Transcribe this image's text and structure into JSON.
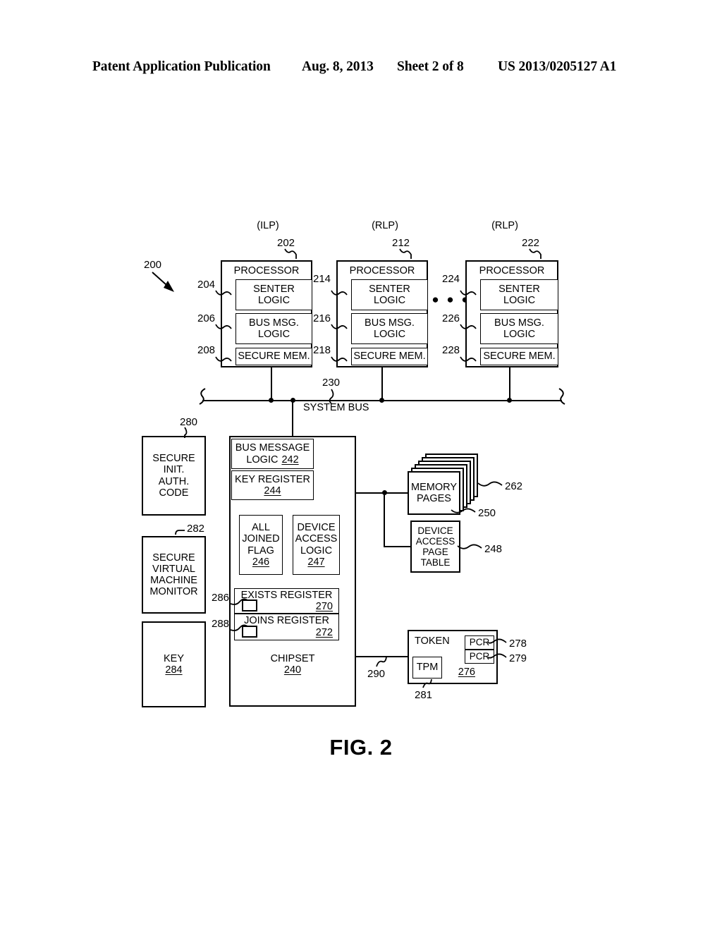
{
  "header": {
    "publication": "Patent Application Publication",
    "date": "Aug. 8, 2013",
    "sheet": "Sheet 2 of 8",
    "patent_number": "US 2013/0205127 A1"
  },
  "figure": {
    "caption": "FIG. 2",
    "system_ref": "200",
    "system_bus": {
      "label": "SYSTEM BUS",
      "ref": "230"
    },
    "processors": [
      {
        "type_label": "(ILP)",
        "ref": "202",
        "title": "PROCESSOR",
        "blocks": [
          {
            "label": "SENTER LOGIC",
            "line1": "SENTER",
            "line2": "LOGIC",
            "ref": "204"
          },
          {
            "label": "BUS MSG. LOGIC",
            "line1": "BUS MSG.",
            "line2": "LOGIC",
            "ref": "206"
          },
          {
            "label": "SECURE MEM.",
            "line1": "SECURE MEM.",
            "line2": "",
            "ref": "208"
          }
        ]
      },
      {
        "type_label": "(RLP)",
        "ref": "212",
        "title": "PROCESSOR",
        "blocks": [
          {
            "label": "SENTER LOGIC",
            "line1": "SENTER",
            "line2": "LOGIC",
            "ref": "214"
          },
          {
            "label": "BUS MSG. LOGIC",
            "line1": "BUS MSG.",
            "line2": "LOGIC",
            "ref": "216"
          },
          {
            "label": "SECURE MEM.",
            "line1": "SECURE MEM.",
            "line2": "",
            "ref": "218"
          }
        ]
      },
      {
        "type_label": "(RLP)",
        "ref": "222",
        "title": "PROCESSOR",
        "blocks": [
          {
            "label": "SENTER LOGIC",
            "line1": "SENTER",
            "line2": "LOGIC",
            "ref": "224"
          },
          {
            "label": "BUS MSG. LOGIC",
            "line1": "BUS MSG.",
            "line2": "LOGIC",
            "ref": "226"
          },
          {
            "label": "SECURE MEM.",
            "line1": "SECURE MEM.",
            "line2": "",
            "ref": "228"
          }
        ]
      }
    ],
    "ellipsis": "● ● ●",
    "left_column": [
      {
        "name": "secure-init-auth-code",
        "lines": [
          "SECURE",
          "INIT.",
          "AUTH.",
          "CODE"
        ],
        "ref": "280"
      },
      {
        "name": "secure-virtual-machine-monitor",
        "lines": [
          "SECURE",
          "VIRTUAL",
          "MACHINE",
          "MONITOR"
        ],
        "ref": "282"
      },
      {
        "name": "key",
        "lines": [
          "KEY"
        ],
        "ref": "284"
      }
    ],
    "chipset": {
      "title": "CHIPSET",
      "ref": "240",
      "bus_message_logic": {
        "line1": "BUS MESSAGE",
        "line2": "LOGIC",
        "ref": "242"
      },
      "key_register": {
        "line1": "KEY REGISTER",
        "ref": "244"
      },
      "all_joined_flag": {
        "lines": [
          "ALL",
          "JOINED",
          "FLAG"
        ],
        "ref": "246"
      },
      "device_access_logic": {
        "lines": [
          "DEVICE",
          "ACCESS",
          "LOGIC"
        ],
        "ref": "247"
      },
      "exists_register": {
        "label": "EXISTS REGISTER",
        "ref": "270",
        "lead_ref": "286"
      },
      "joins_register": {
        "label": "JOINS REGISTER",
        "ref": "272",
        "lead_ref": "288"
      }
    },
    "memory_pages": {
      "line1": "MEMORY",
      "line2": "PAGES",
      "ref_stack": "262",
      "ref_front": "250"
    },
    "device_access_page_table": {
      "lines": [
        "DEVICE",
        "ACCESS",
        "PAGE",
        "TABLE"
      ],
      "ref": "248"
    },
    "token": {
      "title": "TOKEN",
      "ref": "276",
      "tpm": {
        "label": "TPM",
        "ref": "281"
      },
      "pcr_upper": {
        "label": "PCR",
        "ref": "278"
      },
      "pcr_lower": {
        "label": "PCR",
        "ref": "279"
      },
      "link_ref": "290"
    }
  }
}
